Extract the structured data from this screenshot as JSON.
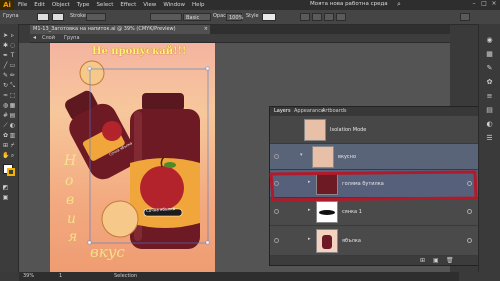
{
  "app": {
    "logo": "Ai"
  },
  "menu": [
    "File",
    "Edit",
    "Object",
    "Type",
    "Select",
    "Effect",
    "View",
    "Window",
    "Help"
  ],
  "window_title": "Моята нова работна среда",
  "control_bar": {
    "selection_label": "Група",
    "stroke_label": "Stroke",
    "basic_label": "Basic",
    "opacity_label": "Opacity",
    "opacity_value": "100%",
    "style_label": "Style"
  },
  "document_tab": {
    "title": "M1-13_Заготовка на напиток.ai @ 39% (CMYK/Preview)",
    "close": "×"
  },
  "crumb": {
    "layer": "Слой",
    "group": "Група"
  },
  "artwork": {
    "headline": "Не пропускай!!!",
    "vertical_1": "Н",
    "vertical_2": "о",
    "vertical_3": "в",
    "vertical_4": "и",
    "vertical_5": "я",
    "word": "вкус",
    "label_1": "Сочна ябълка",
    "label_2": "Сочна ябълка"
  },
  "status": {
    "zoom": "39%",
    "page": "1",
    "tool": "Selection"
  },
  "layers_panel": {
    "tabs": [
      "Layers",
      "Appearance",
      "Artboards"
    ],
    "rows": [
      {
        "name": "Isolation Mode"
      },
      {
        "name": "вкусно"
      },
      {
        "name": "голяма бутилка"
      },
      {
        "name": "сянка 1"
      },
      {
        "name": "ябълка"
      }
    ]
  },
  "colors": {
    "highlight": "#b11a2a",
    "artboard_top": "#f4b4a0",
    "headline": "#fff86a",
    "bottle": "#6e1a24"
  }
}
